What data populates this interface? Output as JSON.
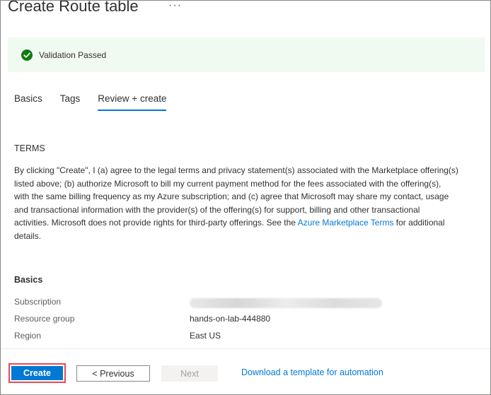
{
  "header": {
    "title": "Create Route table",
    "more_label": "···"
  },
  "validation": {
    "text": "Validation Passed",
    "color": "#107c10"
  },
  "tabs": [
    {
      "label": "Basics",
      "active": false
    },
    {
      "label": "Tags",
      "active": false
    },
    {
      "label": "Review + create",
      "active": true
    }
  ],
  "terms": {
    "heading": "TERMS",
    "line1": "By clicking \"Create\", I (a) agree to the legal terms and privacy statement(s) associated with the Marketplace offering(s)",
    "line2": "listed above; (b) authorize Microsoft to bill my current payment method for the fees associated with the offering(s),",
    "line3": "with the same billing frequency as my Azure subscription; and (c) agree that Microsoft may share my contact, usage",
    "line4": "and transactional information with the provider(s) of the offering(s) for support, billing and other transactional",
    "line5_before": "activities. Microsoft does not provide rights for third-party offerings. See the ",
    "line5_link": "Azure Marketplace Terms",
    "line5_after": " for additional",
    "line6": "details."
  },
  "basics": {
    "heading": "Basics",
    "rows": [
      {
        "label": "Subscription",
        "value": ""
      },
      {
        "label": "Resource group",
        "value": "hands-on-lab-444880"
      },
      {
        "label": "Region",
        "value": "East US"
      }
    ]
  },
  "footer": {
    "create_label": "Create",
    "previous_label": "< Previous",
    "next_label": "Next",
    "download_label": "Download a template for automation"
  },
  "colors": {
    "accent": "#0078d4",
    "highlight": "#e74856"
  }
}
